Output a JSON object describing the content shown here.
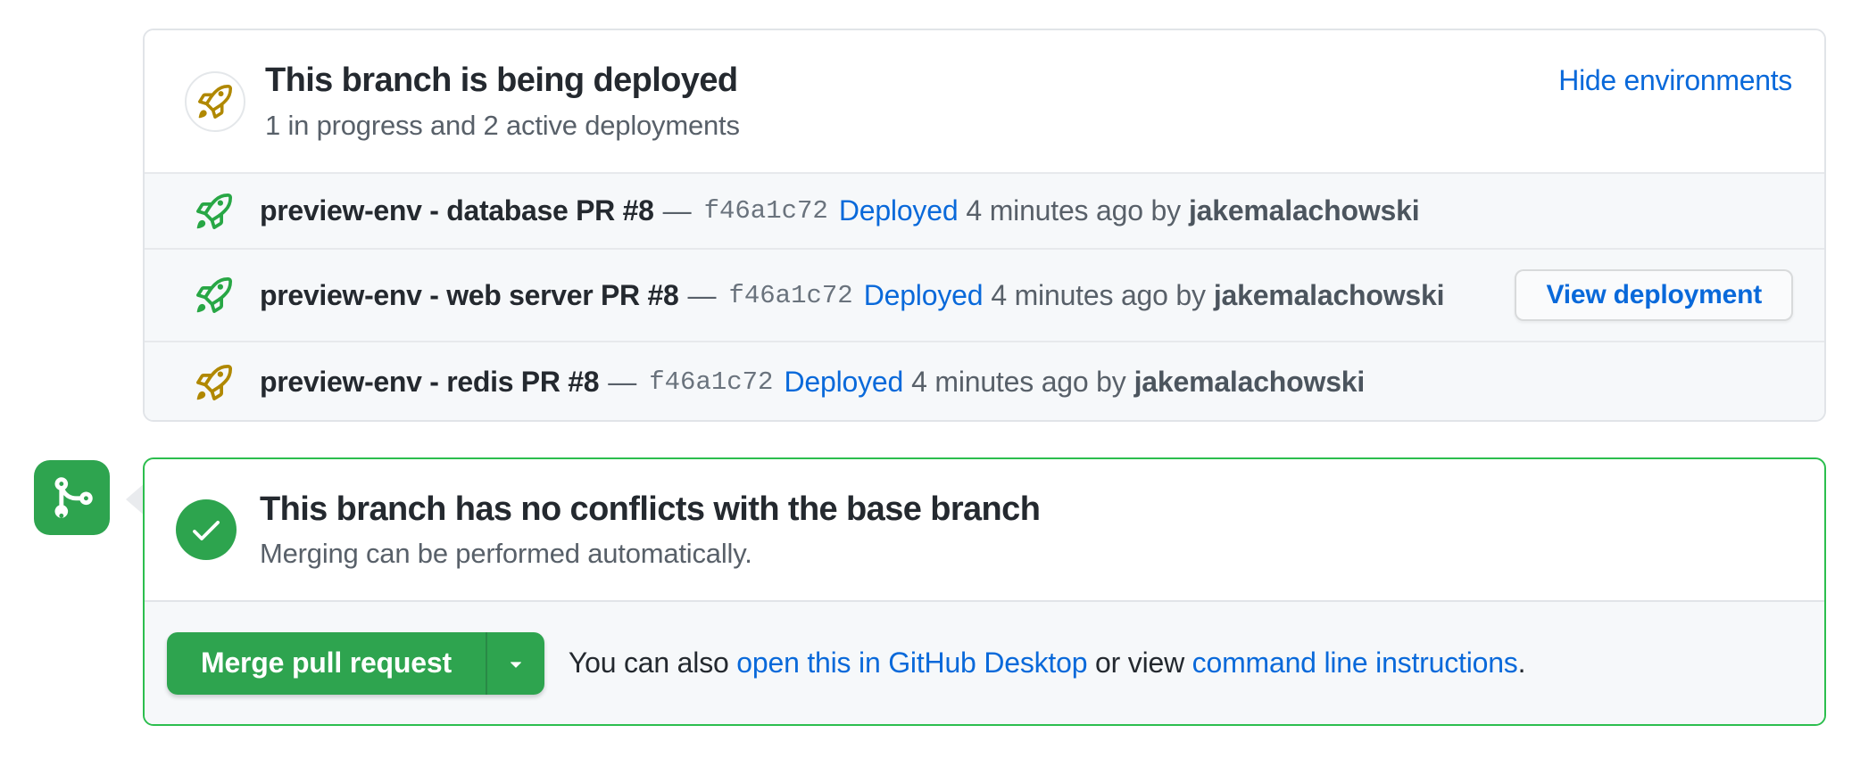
{
  "deployments_card": {
    "title": "This branch is being deployed",
    "subtitle": "1 in progress and 2 active deployments",
    "hide_link": "Hide environments",
    "rows": [
      {
        "name": "preview-env - database PR #8",
        "separator": "—",
        "commit": "f46a1c72",
        "status_link": "Deployed",
        "time_text": "4 minutes ago by",
        "user": "jakemalachowski",
        "rocket_color": "#28a745"
      },
      {
        "name": "preview-env - web server PR #8",
        "separator": "—",
        "commit": "f46a1c72",
        "status_link": "Deployed",
        "time_text": "4 minutes ago by",
        "user": "jakemalachowski",
        "rocket_color": "#28a745",
        "button_label": "View deployment"
      },
      {
        "name": "preview-env - redis PR #8",
        "separator": "—",
        "commit": "f46a1c72",
        "status_link": "Deployed",
        "time_text": "4 minutes ago by",
        "user": "jakemalachowski",
        "rocket_color": "#b08800"
      }
    ]
  },
  "merge_card": {
    "title": "This branch has no conflicts with the base branch",
    "subtitle": "Merging can be performed automatically.",
    "merge_button_label": "Merge pull request",
    "alt_prefix": "You can also ",
    "desktop_link": "open this in GitHub Desktop",
    "alt_middle": " or view ",
    "cli_link": "command line instructions",
    "alt_suffix": "."
  },
  "colors": {
    "link_blue": "#0969da",
    "rocket_green": "#28a745",
    "rocket_gold": "#b08800",
    "merge_border_green": "#2cbe4e",
    "merge_button_green": "#2ea44f",
    "check_circle_green": "#2da44e",
    "row_background": "#f6f8fa",
    "card_border": "#e1e4e8",
    "text_dark": "#24292f",
    "text_gray": "#586069"
  }
}
